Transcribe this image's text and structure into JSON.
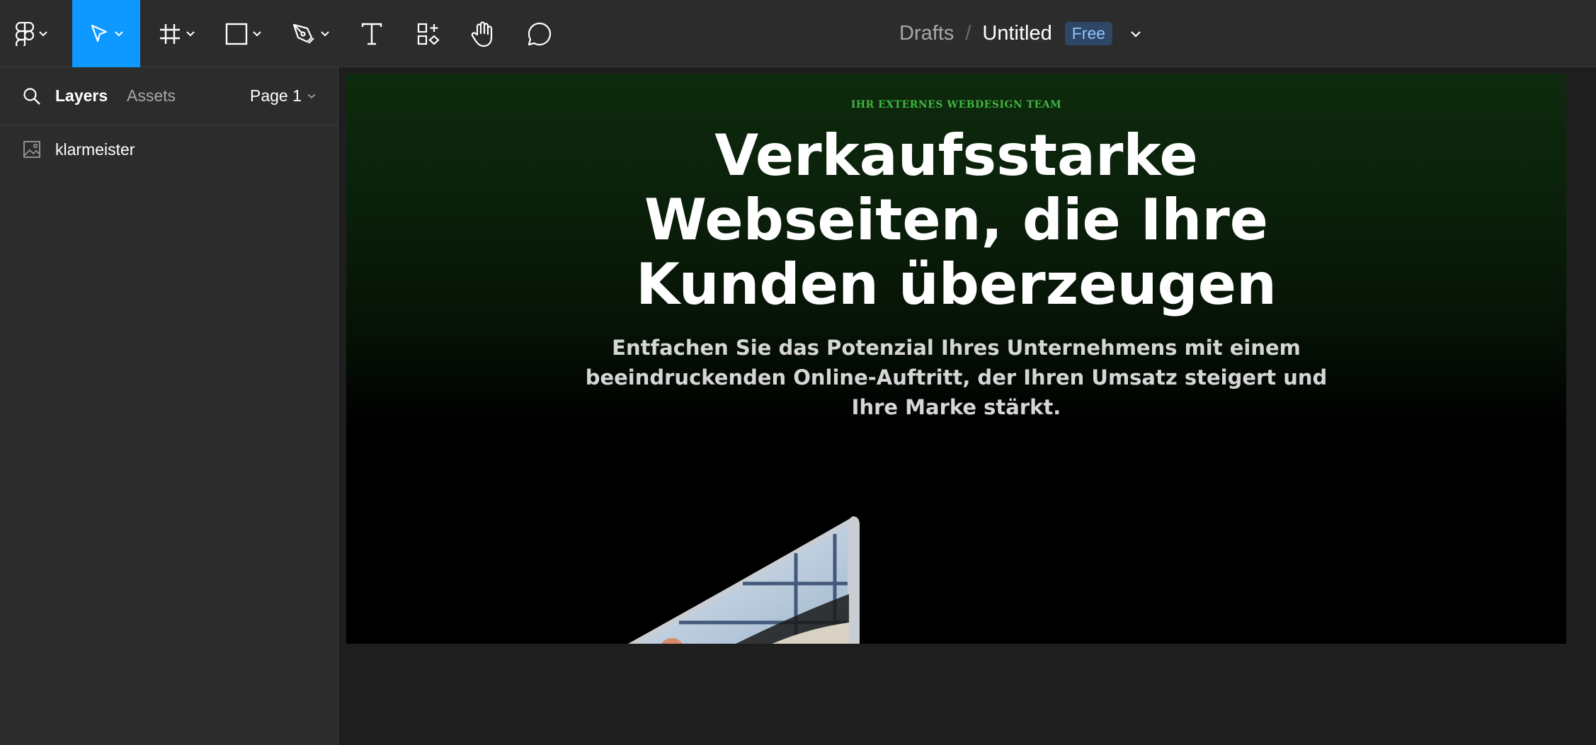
{
  "toolbar": {
    "tools": [
      {
        "name": "main-menu",
        "icon": "figma-logo-icon"
      },
      {
        "name": "move",
        "icon": "cursor-arrow-icon",
        "active": true
      },
      {
        "name": "frame",
        "icon": "frame-hash-icon"
      },
      {
        "name": "shape",
        "icon": "rectangle-icon"
      },
      {
        "name": "pen",
        "icon": "pen-tool-icon"
      },
      {
        "name": "text",
        "icon": "text-t-icon"
      },
      {
        "name": "resources",
        "icon": "resources-icon"
      },
      {
        "name": "hand",
        "icon": "hand-icon"
      },
      {
        "name": "comment",
        "icon": "comment-bubble-icon"
      }
    ],
    "accent_color": "#0d99ff"
  },
  "file": {
    "location": "Drafts",
    "separator": "/",
    "name": "Untitled",
    "plan_badge": "Free"
  },
  "left_panel": {
    "tabs": {
      "layers": "Layers",
      "assets": "Assets"
    },
    "page_selector": "Page 1",
    "layers": [
      {
        "label": "klarmeister",
        "icon": "image-icon"
      }
    ]
  },
  "canvas": {
    "hero": {
      "eyebrow": "IHR EXTERNES WEBDESIGN TEAM",
      "headline_lines": [
        "Verkaufsstarke",
        "Webseiten, die Ihre",
        "Kunden überzeugen"
      ],
      "subline": "Entfachen Sie das Potenzial Ihres Unternehmens mit einem beeindruckenden Online-Auftritt, der Ihren Umsatz steigert und Ihre Marke stärkt.",
      "eyebrow_color": "#3fb63f"
    }
  }
}
